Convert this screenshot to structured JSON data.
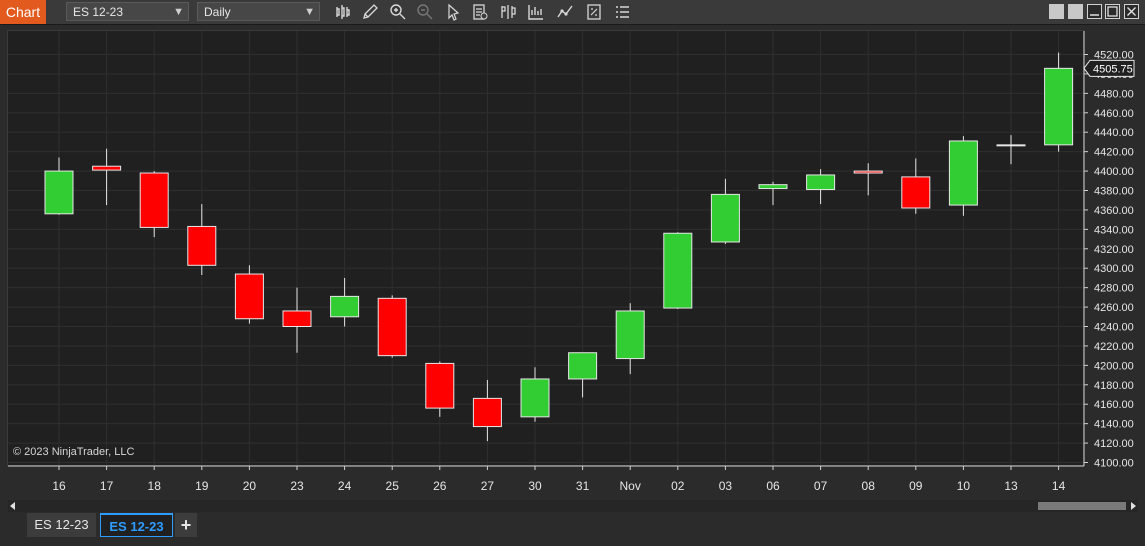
{
  "toolbar": {
    "chart_label": "Chart",
    "instrument": "ES 12-23",
    "interval": "Daily",
    "icons": [
      "bar-type-icon",
      "drawing-pencil-icon",
      "zoom-in-icon",
      "zoom-out-icon",
      "pointer-icon",
      "data-box-icon",
      "chart-trader-icon",
      "strategies-icon",
      "indicators-icon",
      "templates-icon",
      "properties-icon"
    ]
  },
  "copyright": "© 2023 NinjaTrader, LLC",
  "tabs": [
    {
      "label": "ES 12-23",
      "active": false
    },
    {
      "label": "ES 12-23",
      "active": true
    }
  ],
  "add_tab_label": "+",
  "colors": {
    "up": "#32cd32",
    "down": "#ff0000",
    "background": "#202020",
    "grid": "#2f2f2f"
  },
  "chart_data": {
    "type": "candlestick",
    "categories": [
      "16",
      "17",
      "18",
      "19",
      "20",
      "23",
      "24",
      "25",
      "26",
      "27",
      "30",
      "31",
      "Nov",
      "02",
      "03",
      "06",
      "07",
      "08",
      "09",
      "10",
      "13",
      "14"
    ],
    "ohlc": [
      [
        4356,
        4414,
        4355,
        4400
      ],
      [
        4405,
        4423,
        4365,
        4401
      ],
      [
        4398,
        4400,
        4332,
        4342
      ],
      [
        4343,
        4366,
        4293,
        4303
      ],
      [
        4294,
        4303,
        4243,
        4248
      ],
      [
        4256,
        4280,
        4213,
        4240
      ],
      [
        4250,
        4290,
        4240,
        4271
      ],
      [
        4269,
        4272,
        4208,
        4210
      ],
      [
        4202,
        4204,
        4147,
        4156
      ],
      [
        4166,
        4185,
        4122,
        4137
      ],
      [
        4147,
        4198,
        4142,
        4186
      ],
      [
        4186,
        4213,
        4167,
        4213
      ],
      [
        4207,
        4264,
        4191,
        4256
      ],
      [
        4259,
        4337,
        4258,
        4336
      ],
      [
        4327,
        4392,
        4325,
        4376
      ],
      [
        4382,
        4389,
        4365,
        4386
      ],
      [
        4381,
        4402,
        4366,
        4396
      ],
      [
        4400,
        4408,
        4375,
        4398
      ],
      [
        4394,
        4413,
        4356,
        4362
      ],
      [
        4365,
        4436,
        4354,
        4431
      ],
      [
        4426,
        4437,
        4407,
        4427
      ],
      [
        4427,
        4522,
        4420,
        4505.75
      ]
    ],
    "y_ticks": [
      "4520.00",
      "4500.00",
      "4480.00",
      "4460.00",
      "4440.00",
      "4420.00",
      "4400.00",
      "4380.00",
      "4360.00",
      "4340.00",
      "4320.00",
      "4300.00",
      "4280.00",
      "4260.00",
      "4240.00",
      "4220.00",
      "4200.00",
      "4180.00",
      "4160.00",
      "4140.00",
      "4120.00",
      "4100.00"
    ],
    "last_price_label": "4505.75",
    "ylim": [
      4096,
      4532
    ],
    "grid": true
  }
}
